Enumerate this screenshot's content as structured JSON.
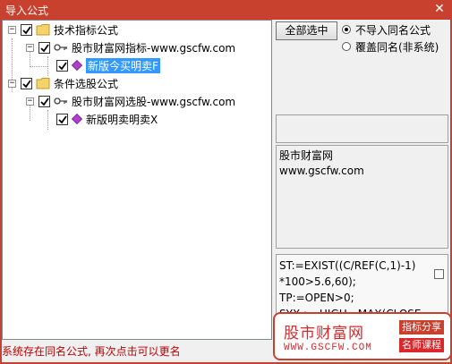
{
  "window": {
    "title": "导入公式",
    "close_glyph": "✕"
  },
  "tree": {
    "nodes": [
      {
        "label": "技术指标公式",
        "checked": true,
        "expanded": true,
        "icon": "folder-icon"
      },
      {
        "label": "股市财富网指标-www.gscfw.com",
        "checked": true,
        "expanded": true,
        "icon": "key-icon"
      },
      {
        "label": "新版今买明卖F",
        "checked": true,
        "selected": true,
        "icon": "diamond-icon"
      },
      {
        "label": "条件选股公式",
        "checked": true,
        "expanded": true,
        "icon": "folder-icon"
      },
      {
        "label": "股市财富网选股-www.gscfw.com",
        "checked": true,
        "expanded": true,
        "icon": "key-icon"
      },
      {
        "label": "新版明卖明卖X",
        "checked": true,
        "icon": "diamond-icon"
      }
    ],
    "expander_glyph": "−"
  },
  "controls": {
    "select_all_label": "全部选中",
    "radio_options": [
      {
        "label": "不导入同名公式",
        "selected": true
      },
      {
        "label": "覆盖同名(非系统)",
        "selected": false
      }
    ]
  },
  "info": {
    "line1": "股市财富网",
    "line2": "www.gscfw.com"
  },
  "code": {
    "lines": [
      "ST:=EXIST((C/REF(C,1)-1)",
      "*100>5.6,60);",
      "TP:=OPEN>0;",
      "SYX := HIGH - MAX(CLOSE,"
    ]
  },
  "status": {
    "message": "系统存在同名公式, 再次点击可以更名"
  },
  "logo": {
    "brand": "股市财富网",
    "url": "WWW.GSCFW.COM",
    "tag1": "指标分享",
    "tag2": "名师课程"
  },
  "colors": {
    "title_bar": "#c8412f",
    "selection": "#3399ff",
    "status_text": "#c00000",
    "logo_red": "#d9282c"
  }
}
